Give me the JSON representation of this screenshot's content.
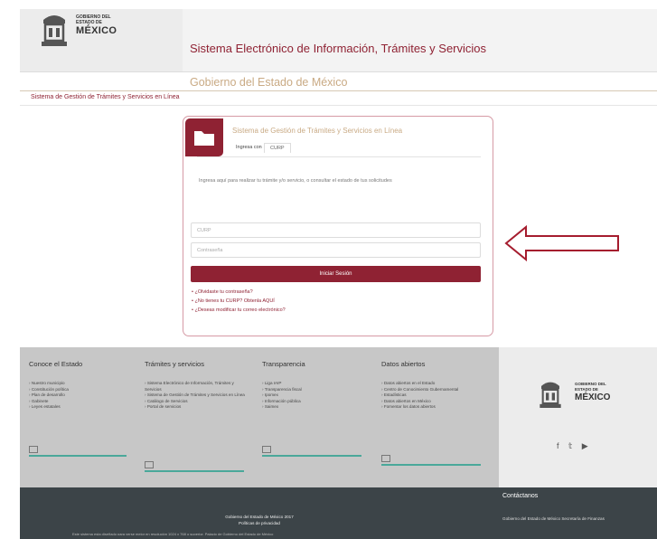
{
  "header": {
    "logo_small_lines": [
      "GOBIERNO DEL",
      "ESTADO DE"
    ],
    "logo_big": "MÉXICO",
    "system_title": "Sistema Electrónico de Información, Trámites y Servicios",
    "government_title": "Gobierno del Estado de México",
    "breadcrumb": "Sistema de Gestión de Trámites y Servicios en Línea"
  },
  "login_card": {
    "title": "Sistema de Gestión de Trámites y Servicios en Línea",
    "tabs": [
      "Ingresa con",
      "CURP"
    ],
    "description": "Ingresa aquí para realizar tu trámite y/o servicio, o consultar el estado de tus solicitudes",
    "curp_placeholder": "CURP",
    "password_placeholder": "Contraseña",
    "login_button": "Iniciar Sesión",
    "links": [
      "¿Olvidaste tu contraseña?",
      "¿No tienes tu CURP? Obtenla AQUÍ",
      "¿Deseas modificar tu correo electrónico?"
    ]
  },
  "annotation": {
    "arrow_color": "#a51c2e"
  },
  "footer": {
    "columns": [
      {
        "heading": "Conoce el Estado",
        "items": [
          "Nuestro municipio",
          "Constitución política",
          "Plan de desarrollo",
          "Gabinete",
          "Leyes estatales"
        ]
      },
      {
        "heading": "Trámites y servicios",
        "items": [
          "Sistema Electrónico de Información, Trámites y Servicios",
          "Sistema de Gestión de Trámites y Servicios en Línea",
          "Catálogo de Servicios",
          "Portal de servicios"
        ]
      },
      {
        "heading": "Transparencia",
        "items": [
          "Liga IAIP",
          "Transparencia fiscal",
          "Ipomex",
          "Información pública",
          "Saimex"
        ]
      },
      {
        "heading": "Datos abiertos",
        "items": [
          "Datos abiertos en el Estado",
          "Centro de Conocimiento Gubernamental",
          "Estadísticas",
          "Datos abiertos en México",
          "Fomentar los datos abiertos"
        ]
      }
    ],
    "logo_small_lines": [
      "GOBIERNO DEL",
      "ESTADO DE"
    ],
    "logo_big": "MÉXICO",
    "social": [
      "f",
      "𝕥",
      "▶"
    ],
    "copyright_lines": [
      "Gobierno del Estado de México 2017",
      "Políticas de privacidad"
    ],
    "copyright_address": "Este sistema esta diseñado para verse mejor en resolución 1024 x 768 o superior. Palacio de Gobierno del Estado de México",
    "contact_title": "Contáctanos",
    "contact_text": "Gobierno del Estado de México Secretaría de Finanzas"
  },
  "colors": {
    "brand": "#8f2233",
    "gold": "#c9aa84",
    "teal_bar": "#4aa89a",
    "footer_gray": "#c7c7c7",
    "footer_dark": "#3c4448"
  }
}
